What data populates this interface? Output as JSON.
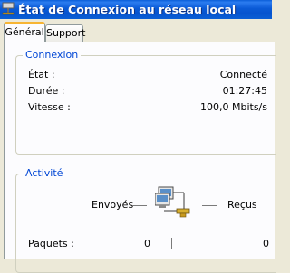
{
  "window": {
    "title": "État de Connexion au réseau local",
    "icon": "network-connection-icon"
  },
  "tabs": [
    {
      "label": "Général",
      "active": true
    },
    {
      "label": "Support",
      "active": false
    }
  ],
  "connection": {
    "legend": "Connexion",
    "rows": [
      {
        "label": "État :",
        "value": "Connecté"
      },
      {
        "label": "Durée :",
        "value": "01:27:45"
      },
      {
        "label": "Vitesse :",
        "value": "100,0 Mbits/s"
      }
    ]
  },
  "activity": {
    "legend": "Activité",
    "sent_label": "Envoyés",
    "received_label": "Reçus",
    "icon": "network-computers-icon",
    "packets_label": "Paquets :",
    "packets_sent": "0",
    "packets_received": "0"
  },
  "colors": {
    "titlebar": "#0a5ad6",
    "group_legend": "#0046d5",
    "active_tab_accent": "#f7b533",
    "panel_background": "#fcfcfe",
    "window_background": "#ece9d8"
  }
}
